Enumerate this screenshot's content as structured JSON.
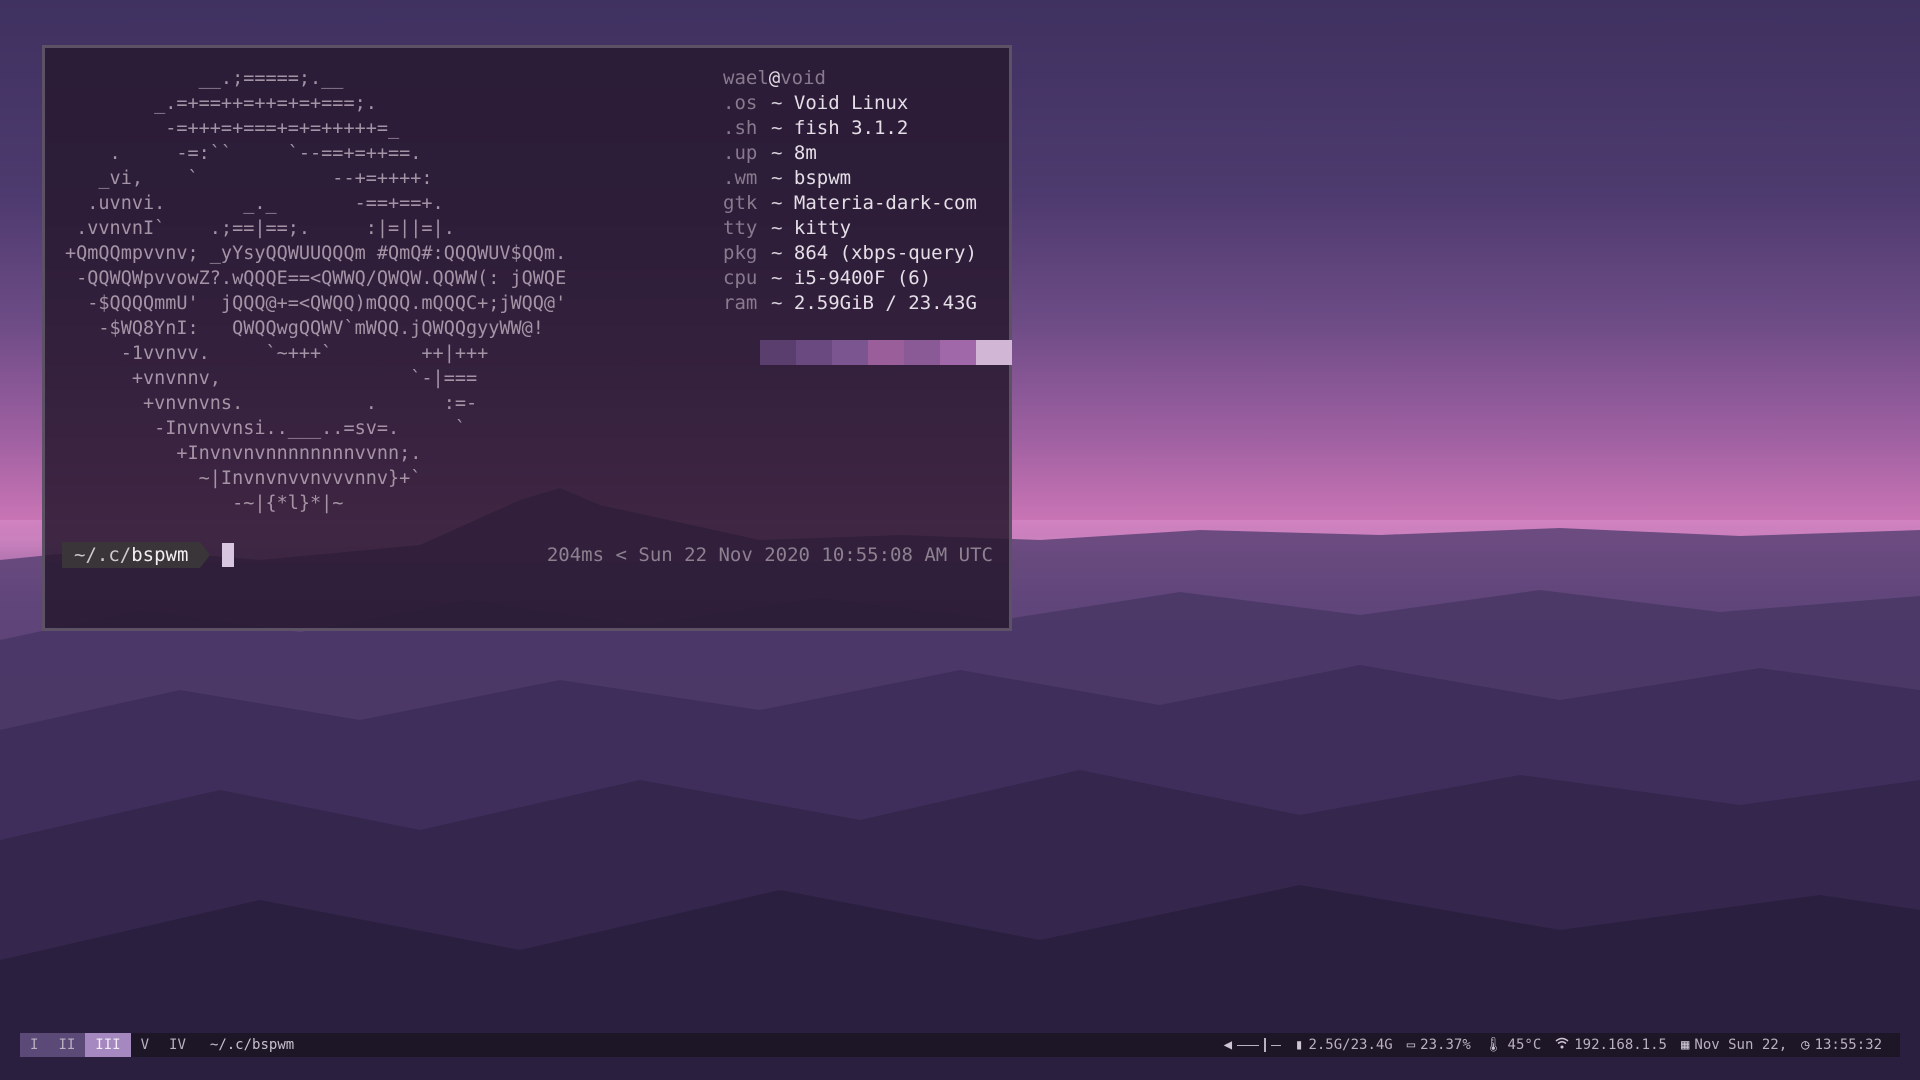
{
  "desktop": {
    "wallpaper": "purple mountain range at dusk"
  },
  "terminal": {
    "ascii_art": [
      "            __.;=====;.__",
      "        _.=+==++=++=+=+===;.",
      "         -=+++=+===+=+=+++++=_",
      "    .     -=:``     `--==+=++==.",
      "   _vi,    `            --+=++++:",
      "  .uvnvi.       _._       -==+==+.",
      " .vvnvnI`    .;==|==;.     :|=||=|.",
      "+QmQQmpvvnv; _yYsyQQWUUQQQm #QmQ#:QQQWUV$QQm.",
      " -QQWQWpvvowZ?.wQQQE==<QWWQ/QWQW.QQWW(: jQWQE",
      "  -$QQQQmmU'  jQQQ@+=<QWQQ)mQQQ.mQQQC+;jWQQ@'",
      "   -$WQ8YnI:   QWQQwgQQWV`mWQQ.jQWQQgyyWW@!",
      "     -1vvnvv.     `~+++`        ++|+++",
      "      +vnvnnv,                 `-|===",
      "       +vnvnvns.           .      :=-",
      "        -Invnvvnsi..___..=sv=.     `",
      "          +Invnvnvnnnnnnnnvvnn;.",
      "            ~|Invnvnvvnvvvnnv}+`",
      "               -~|{*l}*|~"
    ],
    "userhost": {
      "user": "wael",
      "at": "@",
      "host": "void"
    },
    "info": [
      {
        "key": ".os",
        "sep": "~",
        "value": "Void Linux"
      },
      {
        "key": ".sh",
        "sep": "~",
        "value": "fish 3.1.2"
      },
      {
        "key": ".up",
        "sep": "~",
        "value": "8m"
      },
      {
        "key": ".wm",
        "sep": "~",
        "value": "bspwm"
      },
      {
        "key": "gtk",
        "sep": "~",
        "value": "Materia-dark-com"
      },
      {
        "key": "tty",
        "sep": "~",
        "value": "kitty"
      },
      {
        "key": "pkg",
        "sep": "~",
        "value": "864 (xbps-query)"
      },
      {
        "key": "cpu",
        "sep": "~",
        "value": "i5-9400F (6)"
      },
      {
        "key": "ram",
        "sep": "~",
        "value": "2.59GiB / 23.43G"
      }
    ],
    "palette": [
      "#5a3f6e",
      "#6a4880",
      "#7b5590",
      "#9a5e9a",
      "#8a5a96",
      "#a068a8",
      "#d2b6d6"
    ],
    "prompt": {
      "prefix": "~/.c/",
      "cwd": "bspwm"
    },
    "right_prompt": {
      "duration": "204ms",
      "chevron": "<",
      "datetime": "Sun 22 Nov 2020 10:55:08 AM UTC"
    }
  },
  "statusbar": {
    "workspaces": [
      {
        "label": "I",
        "state": "occupied"
      },
      {
        "label": "II",
        "state": "occupied"
      },
      {
        "label": "III",
        "state": "active"
      },
      {
        "label": "V",
        "state": "empty"
      },
      {
        "label": "IV",
        "state": "empty"
      }
    ],
    "window_title": "~/.c/bspwm",
    "modules": {
      "volume_icon": "speaker-icon",
      "memory": "2.5G/23.4G",
      "cpu": "23.37%",
      "temp": "45°C",
      "ip": "192.168.1.5",
      "date": "Nov Sun 22,",
      "time": "13:55:32"
    }
  }
}
